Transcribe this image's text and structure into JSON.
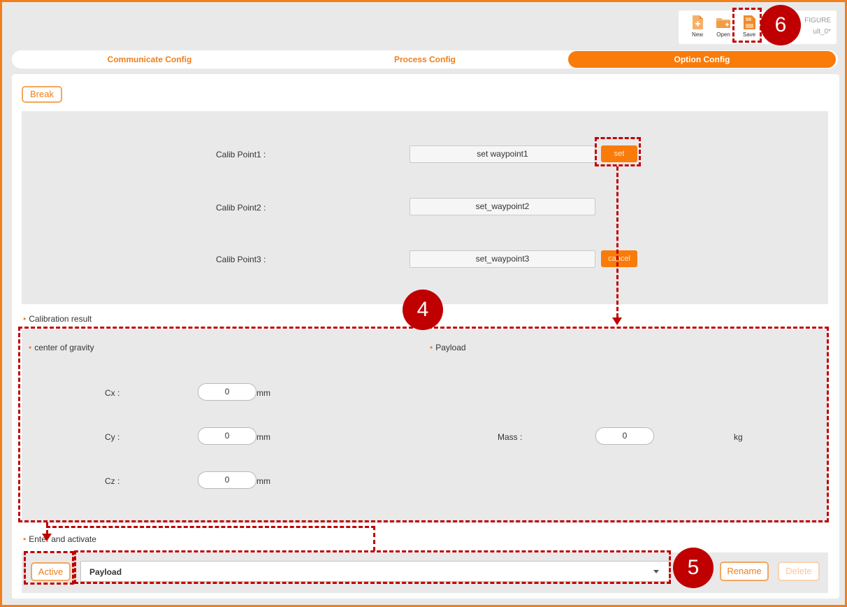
{
  "toolbar": {
    "new_label": "New",
    "open_label": "Open",
    "save_label": "Save",
    "config_title": "FIGURE",
    "config_file": "ult_0*"
  },
  "tabs": [
    {
      "label": "Communicate Config",
      "active": false
    },
    {
      "label": "Process Config",
      "active": false
    },
    {
      "label": "Option Config",
      "active": true
    }
  ],
  "break_label": "Break",
  "calibration": {
    "points": [
      {
        "label": "Calib Point1 :",
        "waypoint": "set waypoint1",
        "action": "set"
      },
      {
        "label": "Calib Point2 :",
        "waypoint": "set_waypoint2",
        "action": ""
      },
      {
        "label": "Calib Point3 :",
        "waypoint": "set_waypoint3",
        "action": "cancel"
      }
    ]
  },
  "result": {
    "title": "Calibration result",
    "cog_title": "center of gravity",
    "payload_title": "Payload",
    "cx": {
      "label": "Cx :",
      "value": "0",
      "unit": "mm"
    },
    "cy": {
      "label": "Cy :",
      "value": "0",
      "unit": "mm"
    },
    "cz": {
      "label": "Cz :",
      "value": "0",
      "unit": "mm"
    },
    "mass": {
      "label": "Mass :",
      "value": "0",
      "unit": "kg"
    }
  },
  "activate": {
    "title": "Enter and activate",
    "active_label": "Active",
    "selected": "Payload",
    "rename_label": "Rename",
    "delete_label": "Delete"
  },
  "annotations": {
    "badge4": "4",
    "badge5": "5",
    "badge6": "6"
  },
  "colors": {
    "accent": "#f97b0a",
    "annotation": "#c00000",
    "panel_bg": "#e9e9ea"
  }
}
